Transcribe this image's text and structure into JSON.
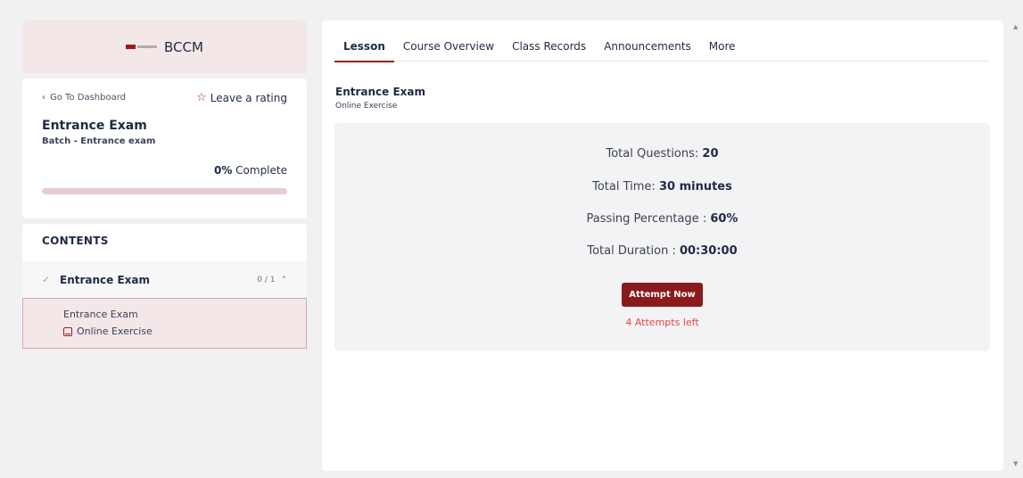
{
  "brand": {
    "name": "BCCM"
  },
  "course_card": {
    "back_label": "Go To Dashboard",
    "rating_label": "Leave a rating",
    "title": "Entrance Exam",
    "batch": "Batch - Entrance exam",
    "progress_value": "0%",
    "progress_suffix": " Complete",
    "progress_fraction": 0
  },
  "contents": {
    "title": "CONTENTS",
    "section": {
      "name": "Entrance Exam",
      "count": "0 / 1"
    },
    "lesson": {
      "name": "Entrance Exam",
      "type": "Online Exercise"
    }
  },
  "tabs": [
    "Lesson",
    "Course Overview",
    "Class Records",
    "Announcements",
    "More"
  ],
  "lesson_header": {
    "title": "Entrance Exam",
    "subtitle": "Online Exercise"
  },
  "info": {
    "total_questions_label": "Total Questions: ",
    "total_questions_value": "20",
    "total_time_label": "Total Time: ",
    "total_time_value": "30 minutes",
    "passing_label": "Passing Percentage : ",
    "passing_value": "60%",
    "duration_label": "Total Duration : ",
    "duration_value": "00:30:00",
    "attempt_button": "Attempt Now",
    "attempts_left": "4 Attempts left"
  },
  "colors": {
    "accent": "#9b1c1f",
    "brand_bg": "#f3e7e7",
    "alert": "#e24545"
  }
}
